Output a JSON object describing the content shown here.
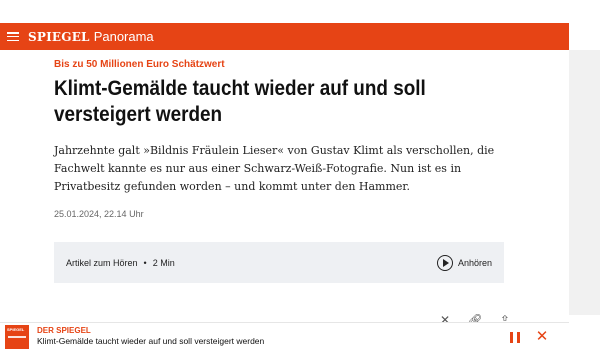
{
  "header": {
    "brand": "SPIEGEL",
    "section": "Panorama"
  },
  "article": {
    "kicker": "Bis zu 50 Millionen Euro Schätzwert",
    "headline": "Klimt-Gemälde taucht wieder auf und soll versteigert werden",
    "intro": "Jahrzehnte galt »Bildnis Fräulein Lieser« von Gustav Klimt als verschollen, die Fachwelt kannte es nur aus einer Schwarz-Weiß-Fotografie. Nun ist es in Privatbesitz gefunden worden – und kommt unter den Hammer.",
    "date": "25.01.2024, 22.14 Uhr"
  },
  "audio": {
    "label": "Artikel zum Hören",
    "separator": "•",
    "duration": "2 Min",
    "listen_label": "Anhören"
  },
  "share": {
    "icons": [
      "x-icon",
      "link-icon",
      "share-icon"
    ]
  },
  "player": {
    "source": "DER SPIEGEL",
    "title": "Klimt-Gemälde taucht wieder auf und soll versteigert werden",
    "thumb_label": "SPIEGEL",
    "close_glyph": "✕"
  },
  "colors": {
    "brand": "#e64415",
    "audio_bg": "#eef0f3"
  }
}
